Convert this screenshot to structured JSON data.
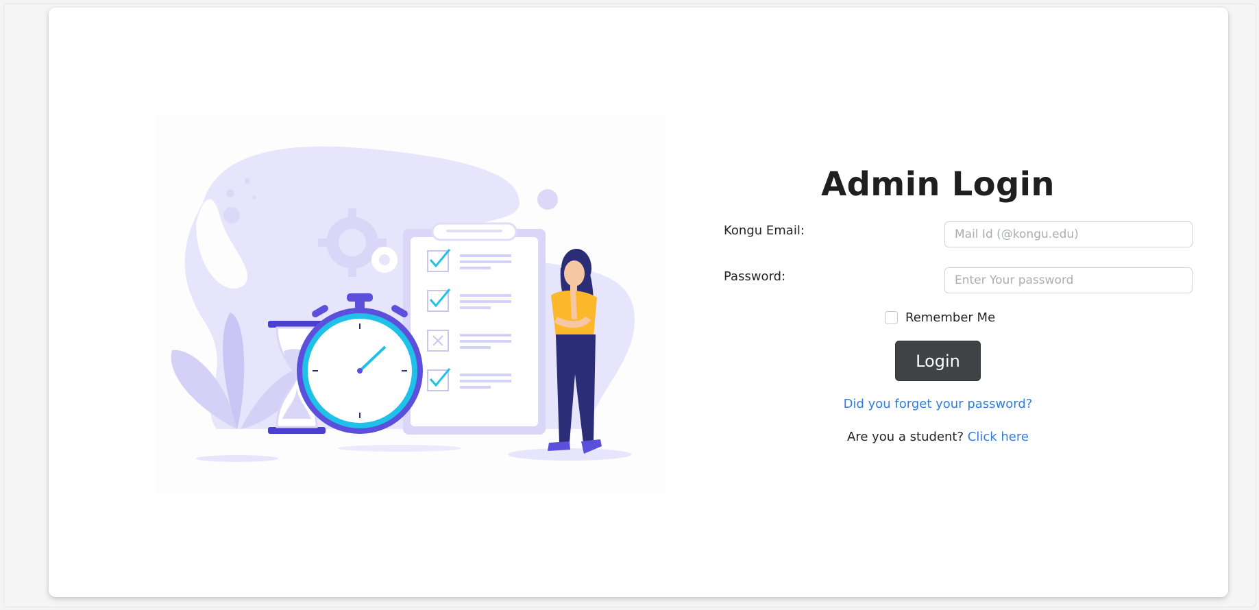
{
  "page": {
    "title": "Admin Login"
  },
  "form": {
    "email_label": "Kongu Email:",
    "email_placeholder": "Mail Id (@kongu.edu)",
    "email_value": "",
    "password_label": "Password:",
    "password_placeholder": "Enter Your password",
    "password_value": "",
    "remember_label": "Remember Me",
    "remember_checked": false,
    "login_button": "Login",
    "forgot_link": "Did you forget your password?",
    "student_prompt": "Are you a student?",
    "student_link": "Click here"
  },
  "illustration": {
    "icon": "checklist-stopwatch-woman-illustration"
  },
  "colors": {
    "accent_link": "#2f7de1",
    "button_bg": "#3f4346",
    "illustration_primary": "#5b4fdb",
    "illustration_light": "#e5e3fb",
    "illustration_cyan": "#1fc1e8",
    "illustration_yellow": "#fbb82b",
    "illustration_navy": "#2b2d77"
  }
}
